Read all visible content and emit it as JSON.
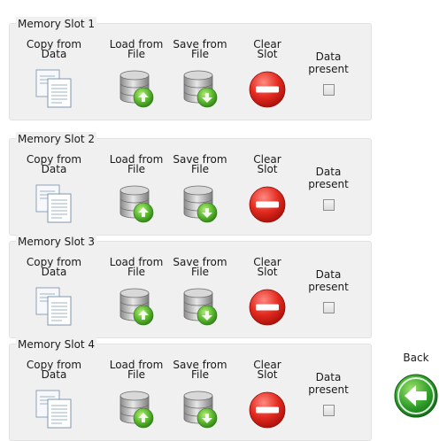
{
  "slots": [
    {
      "title": "Memory Slot 1"
    },
    {
      "title": "Memory Slot 2"
    },
    {
      "title": "Memory Slot 3"
    },
    {
      "title": "Memory Slot 4"
    }
  ],
  "actions": {
    "copy_from_data": "Copy from\nData",
    "load_from_file": "Load from\nFile",
    "save_from_file": "Save from\nFile",
    "clear_slot": "Clear\nSlot"
  },
  "data_present_label": "Data present",
  "back_label": "Back",
  "colors": {
    "clear_red": "#d9251c",
    "db_green": "#5fb42c",
    "back_green": "#2e9b2e"
  }
}
